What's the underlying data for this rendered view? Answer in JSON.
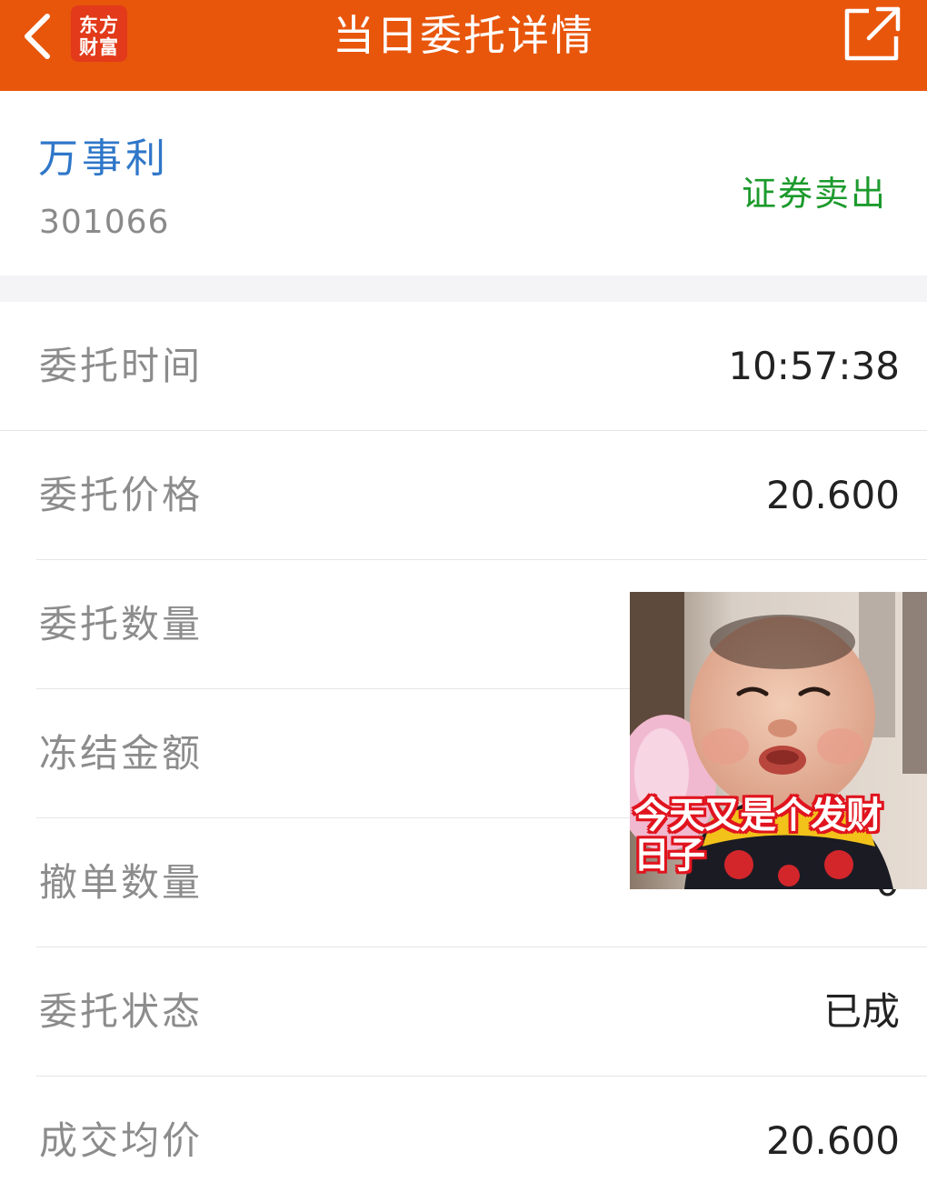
{
  "header": {
    "title": "当日委托详情",
    "brand_line1": "东方",
    "brand_line2": "财富",
    "back_icon": "chevron-left-icon",
    "share_icon": "external-share-icon",
    "color": "#e8560c"
  },
  "stock": {
    "name": "万事利",
    "code": "301066",
    "trade_type": "证券卖出"
  },
  "details": [
    {
      "label": "委托时间",
      "value": "10:57:38"
    },
    {
      "label": "委托价格",
      "value": "20.600"
    },
    {
      "label": "委托数量",
      "value": ""
    },
    {
      "label": "冻结金额",
      "value": ""
    },
    {
      "label": "撤单数量",
      "value": "0"
    },
    {
      "label": "委托状态",
      "value": "已成"
    },
    {
      "label": "成交均价",
      "value": "20.600"
    }
  ],
  "meme": {
    "caption_line1": "今天又是个发财",
    "caption_line2": "日子"
  }
}
